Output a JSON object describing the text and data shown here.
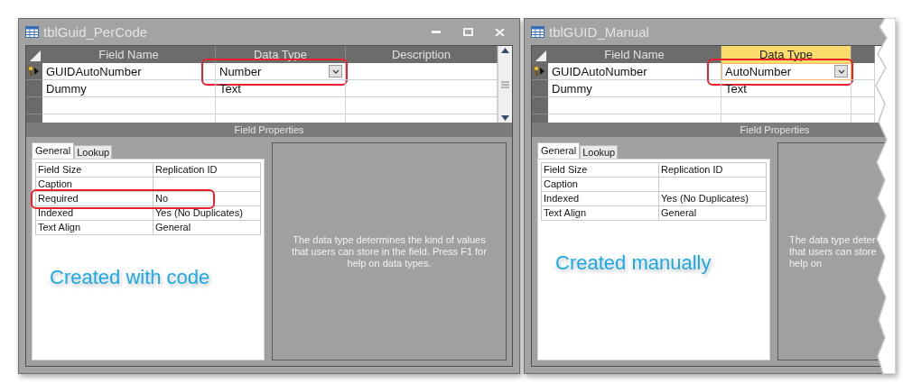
{
  "windows": [
    {
      "title": "tblGuid_PerCode",
      "cut": false,
      "columns": [
        {
          "label": "Field Name",
          "selected": false
        },
        {
          "label": "Data Type",
          "selected": false
        },
        {
          "label": "Description",
          "selected": false
        }
      ],
      "rows": [
        {
          "field_name": "GUIDAutoNumber",
          "data_type": "Number",
          "primary_key": true,
          "current": true,
          "annotated": true
        },
        {
          "field_name": "Dummy",
          "data_type": "Text",
          "primary_key": false,
          "current": false,
          "annotated": false
        }
      ],
      "section_title": "Field Properties",
      "tabs": [
        {
          "label": "General",
          "selected": true
        },
        {
          "label": "Lookup",
          "selected": false
        }
      ],
      "properties": [
        {
          "name": "Field Size",
          "value": "Replication ID",
          "annotated": false
        },
        {
          "name": "Caption",
          "annotated": false
        },
        {
          "name": "Required",
          "value": "No",
          "annotated": true
        },
        {
          "name": "Indexed",
          "value": "Yes (No Duplicates)",
          "annotated": false
        },
        {
          "name": "Text Align",
          "value": "General",
          "annotated": false
        }
      ],
      "help_lines": [
        "The data type determines the kind of values",
        "that users can store in the field. Press F1 for",
        "help on data types."
      ],
      "caption": "Created with code"
    },
    {
      "title": "tblGUID_Manual",
      "cut": true,
      "columns": [
        {
          "label": "Field Name",
          "selected": false
        },
        {
          "label": "Data Type",
          "selected": true
        }
      ],
      "rows": [
        {
          "field_name": "GUIDAutoNumber",
          "data_type": "AutoNumber",
          "primary_key": true,
          "current": true,
          "annotated": true
        },
        {
          "field_name": "Dummy",
          "data_type": "Text",
          "primary_key": false,
          "current": false,
          "annotated": false
        }
      ],
      "section_title": "Field Properties",
      "tabs": [
        {
          "label": "General",
          "selected": true
        },
        {
          "label": "Lookup",
          "selected": false
        }
      ],
      "properties": [
        {
          "name": "Field Size",
          "value": "Replication ID",
          "annotated": false
        },
        {
          "name": "Caption",
          "annotated": false
        },
        {
          "name": "Indexed",
          "value": "Yes (No Duplicates)",
          "annotated": false
        },
        {
          "name": "Text Align",
          "value": "General",
          "annotated": false
        }
      ],
      "help_lines": [
        "The data type deter",
        "that users can store",
        "help on"
      ],
      "caption": "Created manually"
    }
  ]
}
